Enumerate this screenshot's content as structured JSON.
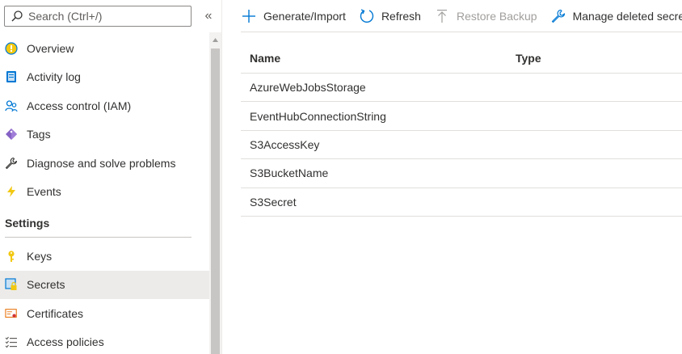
{
  "search": {
    "placeholder": "Search (Ctrl+/)"
  },
  "collapse_glyph": "«",
  "nav": {
    "items": [
      {
        "label": "Overview",
        "icon": "overview-icon"
      },
      {
        "label": "Activity log",
        "icon": "activity-log-icon"
      },
      {
        "label": "Access control (IAM)",
        "icon": "access-control-icon"
      },
      {
        "label": "Tags",
        "icon": "tag-icon"
      },
      {
        "label": "Diagnose and solve problems",
        "icon": "wrench-icon"
      },
      {
        "label": "Events",
        "icon": "lightning-icon"
      }
    ],
    "settings_header": "Settings",
    "settings_items": [
      {
        "label": "Keys",
        "icon": "key-icon"
      },
      {
        "label": "Secrets",
        "icon": "secret-icon",
        "selected": true
      },
      {
        "label": "Certificates",
        "icon": "certificate-icon"
      },
      {
        "label": "Access policies",
        "icon": "access-policies-icon"
      }
    ]
  },
  "toolbar": {
    "generate_import": "Generate/Import",
    "refresh": "Refresh",
    "restore_backup": "Restore Backup",
    "manage_deleted": "Manage deleted secrets"
  },
  "table": {
    "columns": {
      "name": "Name",
      "type": "Type"
    },
    "rows": [
      {
        "name": "AzureWebJobsStorage",
        "type": ""
      },
      {
        "name": "EventHubConnectionString",
        "type": ""
      },
      {
        "name": "S3AccessKey",
        "type": ""
      },
      {
        "name": "S3BucketName",
        "type": ""
      },
      {
        "name": "S3Secret",
        "type": ""
      }
    ]
  },
  "colors": {
    "accent": "#0078d4",
    "selected_bg": "#edebe9",
    "disabled_text": "#a19f9d"
  }
}
